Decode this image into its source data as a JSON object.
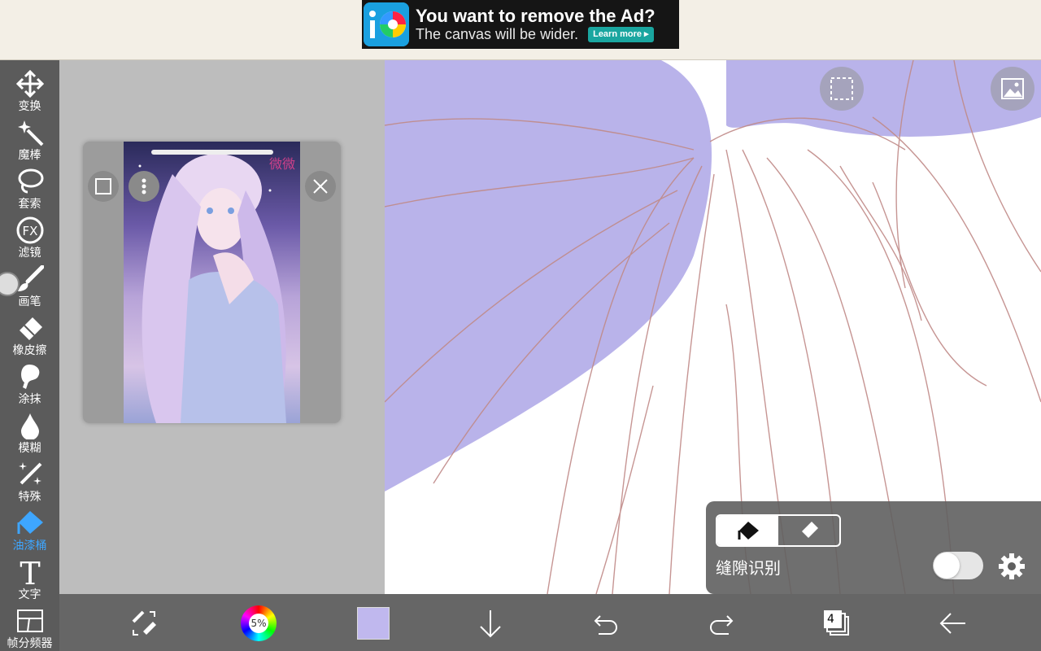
{
  "ad": {
    "title": "You want to remove the Ad?",
    "subtitle": "The canvas will be wider.",
    "button": "Learn more ▸"
  },
  "sidebar": {
    "tools": [
      {
        "label": "变换",
        "icon": "move-icon"
      },
      {
        "label": "魔棒",
        "icon": "magic-wand-icon"
      },
      {
        "label": "套索",
        "icon": "lasso-icon"
      },
      {
        "label": "滤镜",
        "icon": "fx-icon"
      },
      {
        "label": "画笔",
        "icon": "brush-icon"
      },
      {
        "label": "橡皮擦",
        "icon": "eraser-icon"
      },
      {
        "label": "涂抹",
        "icon": "smudge-icon"
      },
      {
        "label": "模糊",
        "icon": "blur-drop-icon"
      },
      {
        "label": "特殊",
        "icon": "special-icon"
      },
      {
        "label": "油漆桶",
        "icon": "paint-bucket-icon"
      },
      {
        "label": "文字",
        "icon": "text-icon"
      },
      {
        "label": "帧分频器",
        "icon": "frame-divider-icon"
      }
    ],
    "active_tool": "油漆桶",
    "active_color": "#3ea6ff"
  },
  "reference_window": {
    "image_stamp": "微微"
  },
  "fill_panel": {
    "gap_label": "缝隙识别",
    "gap_toggle_on": false
  },
  "bottom_bar": {
    "color_wheel_label": "5%",
    "current_color": "#c0b8ee",
    "layers_count": "4"
  },
  "canvas": {
    "fill_color": "#b9b3ea",
    "line_color": "#c08a88"
  }
}
